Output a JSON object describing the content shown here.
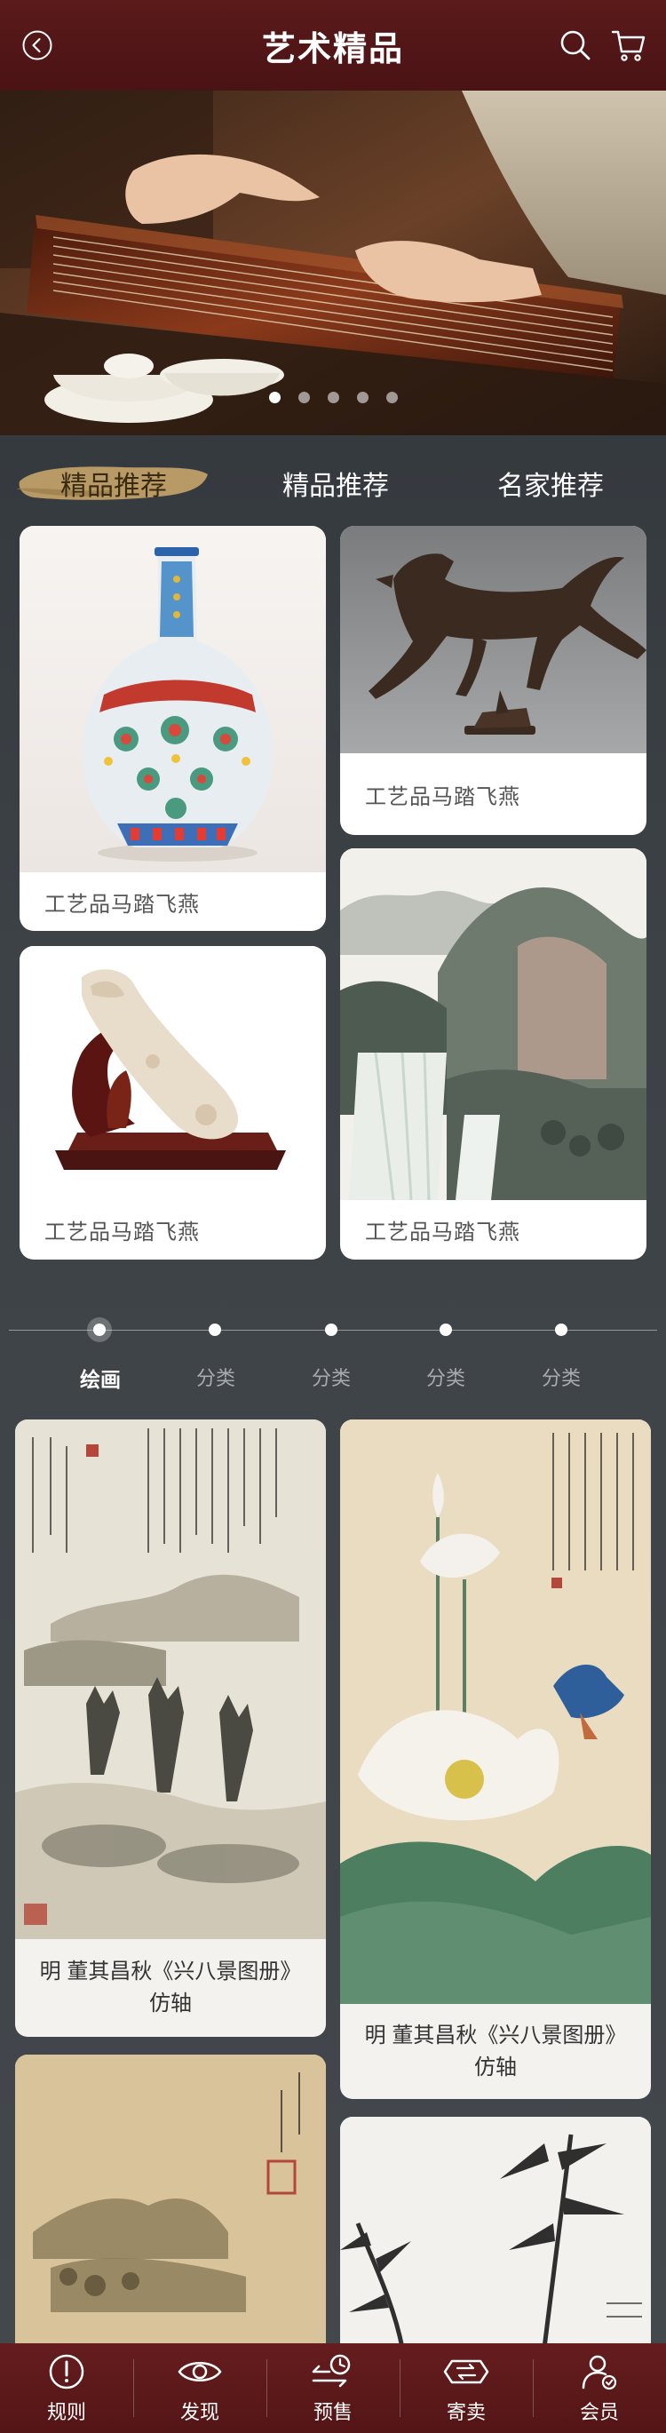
{
  "header": {
    "title": "艺术精品"
  },
  "banner": {
    "slide_count": 5,
    "active_slide": 1
  },
  "tabs": [
    {
      "label": "精品推荐",
      "active": true
    },
    {
      "label": "精品推荐",
      "active": false
    },
    {
      "label": "名家推荐",
      "active": false
    }
  ],
  "recommend_cards": [
    {
      "caption": "工艺品马踏飞燕"
    },
    {
      "caption": "工艺品马踏飞燕"
    },
    {
      "caption": "工艺品马踏飞燕"
    },
    {
      "caption": "工艺品马踏飞燕"
    }
  ],
  "timeline": [
    {
      "label": "绘画",
      "active": true
    },
    {
      "label": "分类",
      "active": false
    },
    {
      "label": "分类",
      "active": false
    },
    {
      "label": "分类",
      "active": false
    },
    {
      "label": "分类",
      "active": false
    }
  ],
  "paintings": [
    {
      "caption": "明  董其昌秋《兴八景图册》仿轴"
    },
    {
      "caption": "明  董其昌秋《兴八景图册》仿轴"
    },
    {
      "caption": ""
    },
    {
      "caption": ""
    }
  ],
  "bottom_nav": [
    {
      "label": "规则",
      "icon": "rules-icon"
    },
    {
      "label": "发现",
      "icon": "eye-icon"
    },
    {
      "label": "预售",
      "icon": "presale-icon"
    },
    {
      "label": "寄卖",
      "icon": "consign-icon"
    },
    {
      "label": "会员",
      "icon": "member-icon"
    }
  ],
  "colors": {
    "header": "#4a1314",
    "nav": "#5e191a",
    "tab_brush": "#b89a66",
    "background": "#3d4247"
  }
}
